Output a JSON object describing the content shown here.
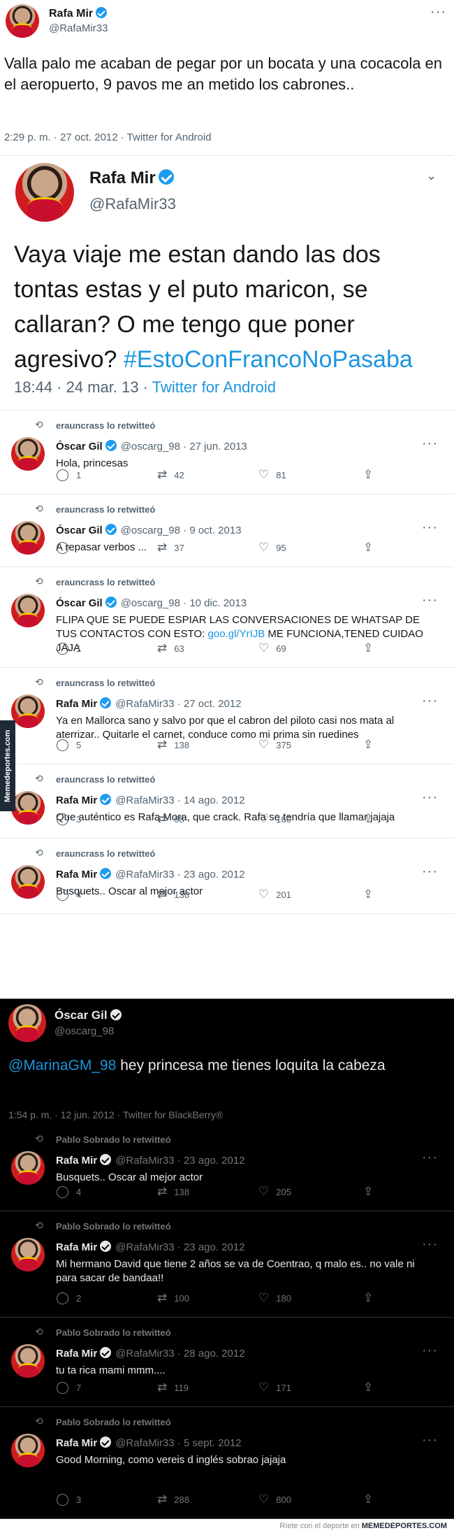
{
  "tweet1": {
    "name": "Rafa Mir",
    "handle": "@RafaMir33",
    "text": "Valla palo me acaban de pegar por un bocata y una cocacola en el aeropuerto, 9 pavos me an metido los cabrones..",
    "timestamp": "2:29 p. m. · 27 oct. 2012 · Twitter for Android"
  },
  "tweet2": {
    "name": "Rafa Mir",
    "handle": "@RafaMir33",
    "text_plain": "Vaya viaje me estan dando las dos tontas estas y el puto maricon, se callaran? O me tengo que poner agresivo? ",
    "hashtag": "#EstoConFrancoNoPasaba",
    "time": "18:44 · 24 mar. 13 · ",
    "client": "Twitter for Android"
  },
  "retweets_light": [
    {
      "rt_by": "erauncrass lo retwitteó",
      "name": "Óscar Gil",
      "handle": "@oscarg_98",
      "date": "27 jun. 2013",
      "text": "Hola, princesas",
      "link": "",
      "text_after": "",
      "replies": "1",
      "retweets": "42",
      "likes": "81"
    },
    {
      "rt_by": "erauncrass lo retwitteó",
      "name": "Óscar Gil",
      "handle": "@oscarg_98",
      "date": "9 oct. 2013",
      "text": "A repasar verbos ...",
      "link": "",
      "text_after": "",
      "replies": "",
      "retweets": "37",
      "likes": "95"
    },
    {
      "rt_by": "erauncrass lo retwitteó",
      "name": "Óscar Gil",
      "handle": "@oscarg_98",
      "date": "10 dic. 2013",
      "text": "FLIPA QUE SE PUEDE ESPIAR LAS CONVERSACIONES DE WHATSAP DE TUS CONTACTOS CON ESTO: ",
      "link": "goo.gl/YrIJB",
      "text_after": " ME FUNCIONA,TENED CUIDAO JAJA",
      "replies": "1",
      "retweets": "63",
      "likes": "69"
    },
    {
      "rt_by": "erauncrass lo retwitteó",
      "name": "Rafa Mir",
      "handle": "@RafaMir33",
      "date": "27 oct. 2012",
      "text": "Ya en Mallorca sano y salvo por que el cabron del piloto casi nos mata al aterrizar.. Quitarle el carnet, conduce como mi prima sin ruedines",
      "link": "",
      "text_after": "",
      "replies": "5",
      "retweets": "138",
      "likes": "375"
    },
    {
      "rt_by": "erauncrass lo retwitteó",
      "name": "Rafa Mir",
      "handle": "@RafaMir33",
      "date": "14 ago. 2012",
      "text": "Que auténtico es Rafa Mora, que crack. Rafa se tendría que llamar jajaja",
      "link": "",
      "text_after": "",
      "replies": "3",
      "retweets": "98",
      "likes": "160"
    },
    {
      "rt_by": "erauncrass lo retwitteó",
      "name": "Rafa Mir",
      "handle": "@RafaMir33",
      "date": "23 ago. 2012",
      "text": "Busquets.. Oscar al mejor actor",
      "link": "",
      "text_after": "",
      "replies": "4",
      "retweets": "136",
      "likes": "201"
    }
  ],
  "tweet3": {
    "name": "Óscar Gil",
    "handle": "@oscarg_98",
    "mention": "@MarinaGM_98",
    "text": " hey princesa me tienes loquita la cabeza",
    "timestamp": "1:54 p. m. · 12 jun. 2012 · Twitter for BlackBerry®"
  },
  "retweets_dark": [
    {
      "rt_by": "Pablo Sobrado lo retwitteó",
      "name": "Rafa Mir",
      "handle": "@RafaMir33",
      "date": "23 ago. 2012",
      "text": "Busquets.. Oscar al mejor actor",
      "replies": "4",
      "retweets": "138",
      "likes": "205"
    },
    {
      "rt_by": "Pablo Sobrado lo retwitteó",
      "name": "Rafa Mir",
      "handle": "@RafaMir33",
      "date": "23 ago. 2012",
      "text": "Mi hermano David que tiene 2 años se va de Coentrao, q malo es.. no vale ni para sacar de bandaa!!",
      "replies": "2",
      "retweets": "100",
      "likes": "180"
    },
    {
      "rt_by": "Pablo Sobrado lo retwitteó",
      "name": "Rafa Mir",
      "handle": "@RafaMir33",
      "date": "28 ago. 2012",
      "text": "tu ta rica mami mmm....",
      "replies": "7",
      "retweets": "119",
      "likes": "171"
    },
    {
      "rt_by": "Pablo Sobrado lo retwitteó",
      "name": "Rafa Mir",
      "handle": "@RafaMir33",
      "date": "5 sept. 2012",
      "text": "Good Morning, como vereis d inglés sobrao jajaja",
      "replies": "3",
      "retweets": "288",
      "likes": "800"
    }
  ],
  "watermark": "Memedeportes.com",
  "footer": {
    "text": "Ríete con el deporte en ",
    "brand": "MEMEDEPORTES.COM"
  }
}
